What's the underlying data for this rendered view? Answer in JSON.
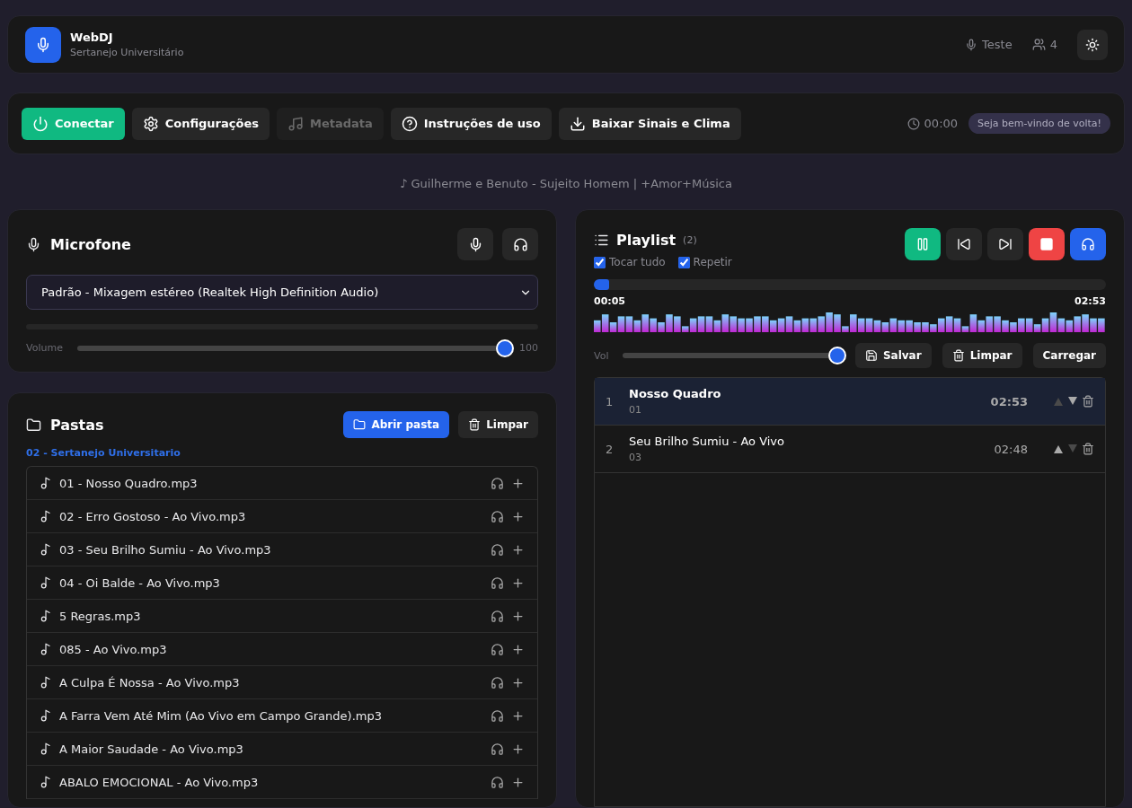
{
  "header": {
    "title": "WebDJ",
    "subtitle": "Sertanejo Universitário",
    "mic_label": "Teste",
    "listeners": "4"
  },
  "toolbar": {
    "buttons": [
      {
        "label": "Conectar",
        "kind": "connect",
        "disabled": false
      },
      {
        "label": "Configurações",
        "kind": "settings",
        "disabled": false
      },
      {
        "label": "Metadata",
        "kind": "metadata",
        "disabled": true
      },
      {
        "label": "Instruções de uso",
        "kind": "help",
        "disabled": false
      },
      {
        "label": "Baixar Sinais e Clima",
        "kind": "download",
        "disabled": false
      }
    ],
    "timer": "00:00",
    "welcome": "Seja bem-vindo de volta!"
  },
  "now_playing": "♪ Guilherme e Benuto - Sujeito Homem | +Amor+Música",
  "microphone": {
    "title": "Microfone",
    "device": "Padrão - Mixagem estéreo (Realtek High Definition Audio)",
    "volume_label": "Volume",
    "volume": {
      "level": 1
    },
    "volume_value": "100"
  },
  "folders": {
    "title": "Pastas",
    "open_button": "Abrir pasta",
    "clear_button": "Limpar",
    "folder_name": "02 - Sertanejo Universitario",
    "files": [
      "01 - Nosso Quadro.mp3",
      "02 - Erro Gostoso - Ao Vivo.mp3",
      "03 - Seu Brilho Sumiu - Ao Vivo.mp3",
      "04 - Oi Balde - Ao Vivo.mp3",
      "5 Regras.mp3",
      "085 - Ao Vivo.mp3",
      "A Culpa É Nossa - Ao Vivo.mp3",
      "A Farra Vem Até Mim (Ao Vivo em Campo Grande).mp3",
      "A Maior Saudade - Ao Vivo.mp3",
      "ABALO EMOCIONAL - Ao Vivo.mp3"
    ]
  },
  "playlist": {
    "title": "Playlist",
    "count": "(2)",
    "play_all": {
      "label": "Tocar tudo",
      "checked": true
    },
    "repeat": {
      "label": "Repetir",
      "checked": true
    },
    "controls": [
      {
        "kind": "pause"
      },
      {
        "kind": "previous"
      },
      {
        "kind": "next"
      },
      {
        "kind": "stop"
      },
      {
        "kind": "monitor"
      }
    ],
    "progress": {
      "level": 0.03
    },
    "elapsed": "00:05",
    "duration": "02:53",
    "volume_label": "Vol",
    "volume": {
      "level": 1
    },
    "save_button": "Salvar",
    "clear_button": "Limpar",
    "load_button": "Carregar",
    "tracks": [
      {
        "number": "1",
        "title": "Nosso Quadro",
        "subtitle": "01",
        "duration": "02:53",
        "selected": true,
        "up_disabled": true,
        "down_disabled": false
      },
      {
        "number": "2",
        "title": "Seu Brilho Sumiu - Ao Vivo",
        "subtitle": "03",
        "duration": "02:48",
        "selected": false,
        "up_disabled": false,
        "down_disabled": true
      }
    ]
  }
}
